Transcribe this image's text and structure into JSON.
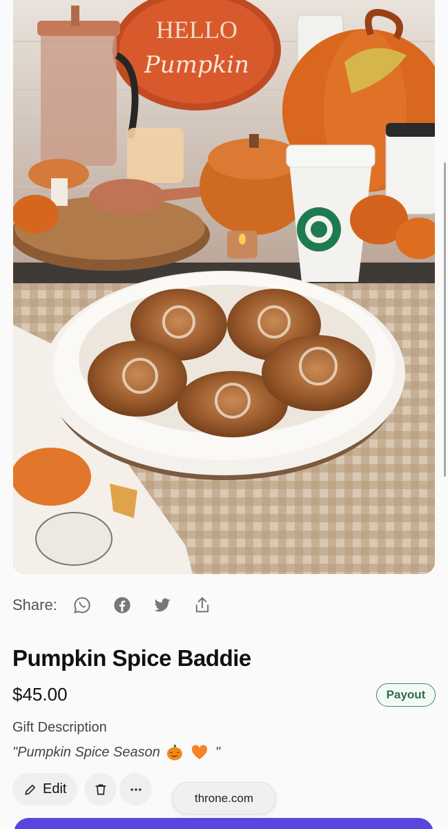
{
  "share": {
    "label": "Share:",
    "icons": [
      "whatsapp-icon",
      "facebook-icon",
      "twitter-icon",
      "share-upload-icon"
    ]
  },
  "product": {
    "title": "Pumpkin Spice Baddie",
    "price": "$45.00",
    "badge": "Payout",
    "description_label": "Gift Description",
    "description_text": "\"Pumpkin Spice Season",
    "description_end": "\""
  },
  "hero_image": {
    "sign_line1": "HELLO",
    "sign_line2": "Pumpkin"
  },
  "actions": {
    "edit_label": "Edit"
  },
  "browser": {
    "url": "throne.com"
  },
  "colors": {
    "accent": "#5a45e0",
    "payout_green": "#3d8b5c",
    "pumpkin_orange": "#d9681e"
  }
}
